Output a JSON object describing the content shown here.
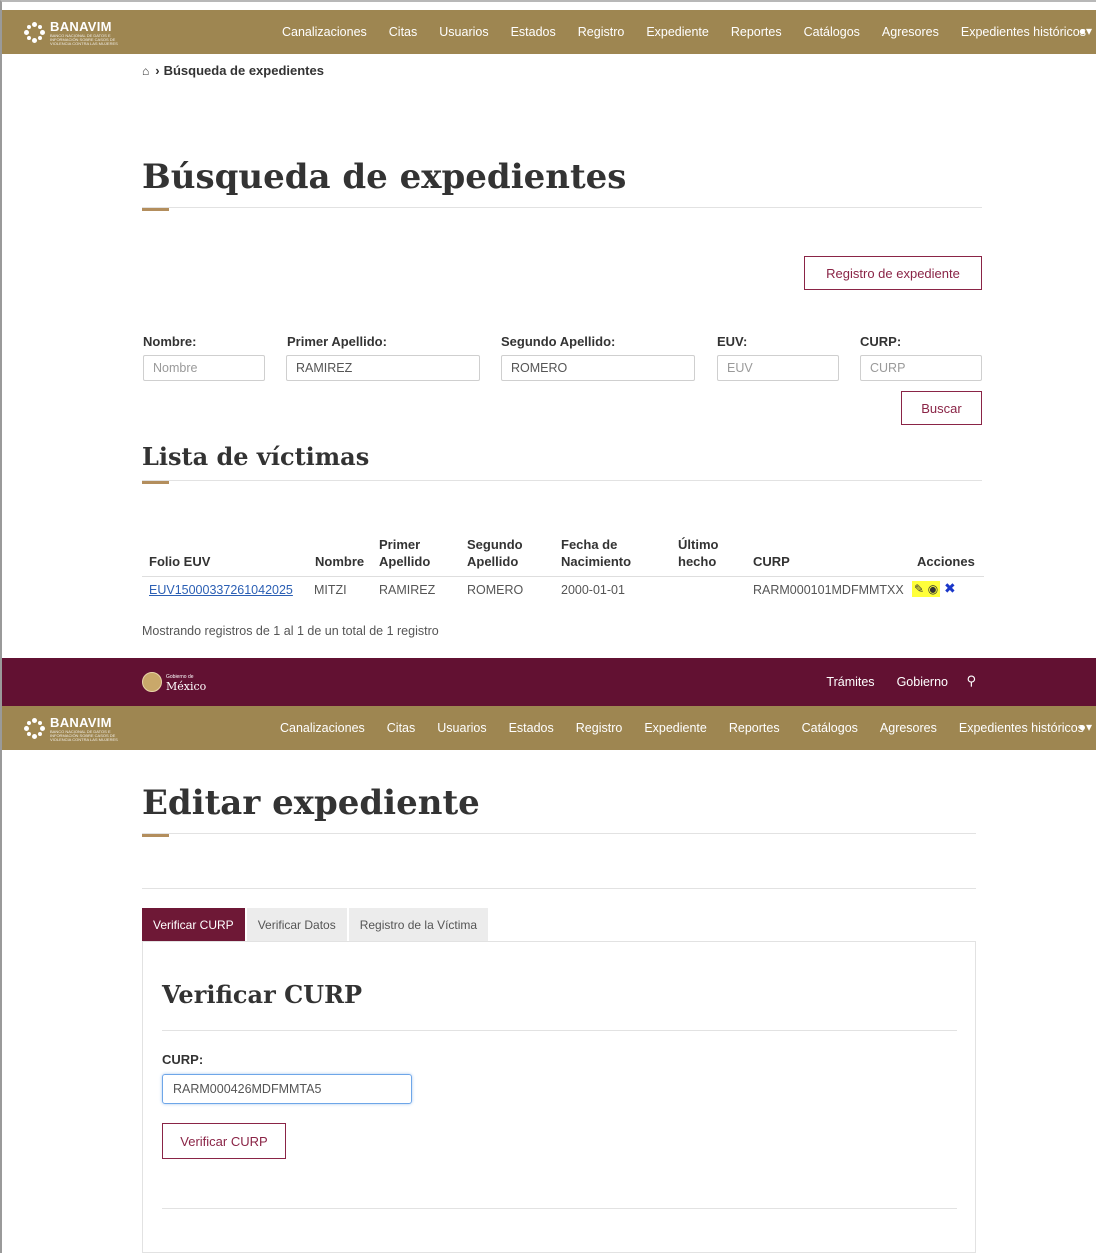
{
  "nav": {
    "brand_name": "BANAVIM",
    "brand_sub": "BANCO NACIONAL DE DATOS E INFORMACIÓN SOBRE CASOS DE VIOLENCIA CONTRA LAS MUJERES",
    "items": [
      "Canalizaciones",
      "Citas",
      "Usuarios",
      "Estados",
      "Registro",
      "Expediente",
      "Reportes",
      "Catálogos",
      "Agresores",
      "Expedientes históricos"
    ],
    "user_caret": "▾"
  },
  "search_page": {
    "breadcrumb": "Búsqueda de expedientes",
    "title": "Búsqueda de expedientes",
    "register_button": "Registro de expediente",
    "fields": {
      "nombre": {
        "label": "Nombre:",
        "value": "",
        "placeholder": "Nombre"
      },
      "primer_apellido": {
        "label": "Primer Apellido:",
        "value": "RAMIREZ",
        "placeholder": ""
      },
      "segundo_apellido": {
        "label": "Segundo Apellido:",
        "value": "ROMERO",
        "placeholder": ""
      },
      "euv": {
        "label": "EUV:",
        "value": "",
        "placeholder": "EUV"
      },
      "curp": {
        "label": "CURP:",
        "value": "",
        "placeholder": "CURP"
      }
    },
    "search_button": "Buscar",
    "list_title": "Lista de víctimas",
    "table": {
      "headers": {
        "folio": "Folio EUV",
        "nombre": "Nombre",
        "primer_apellido_1": "Primer",
        "primer_apellido_2": "Apellido",
        "segundo_apellido_1": "Segundo",
        "segundo_apellido_2": "Apellido",
        "fecha_1": "Fecha de",
        "fecha_2": "Nacimiento",
        "ultimo_1": "Último",
        "ultimo_2": "hecho",
        "curp": "CURP",
        "acciones": "Acciones"
      },
      "rows": [
        {
          "folio": "EUV15000337261042025",
          "nombre": "MITZI",
          "primer_apellido": "RAMIREZ",
          "segundo_apellido": "ROMERO",
          "fecha": "2000-01-01",
          "ultimo": "",
          "curp": "RARM000101MDFMMTXX"
        }
      ]
    },
    "info": "Mostrando registros de 1 al 1 de un total de 1 registro"
  },
  "gob": {
    "small": "Gobierno de",
    "big": "México",
    "links": [
      "Trámites",
      "Gobierno"
    ]
  },
  "edit_page": {
    "title": "Editar expediente",
    "tabs": [
      "Verificar CURP",
      "Verificar Datos",
      "Registro de la Víctima"
    ],
    "section_title": "Verificar CURP",
    "curp_label": "CURP:",
    "curp_value": "RARM000426MDFMMTA5",
    "verify_button": "Verificar CURP"
  },
  "colors": {
    "nav_bg": "#9e8651",
    "gob_bg": "#621132",
    "accent": "#b38e5d",
    "button_border": "#8a2446",
    "tab_active": "#6e1836",
    "action_highlight": "#ffff3a"
  }
}
